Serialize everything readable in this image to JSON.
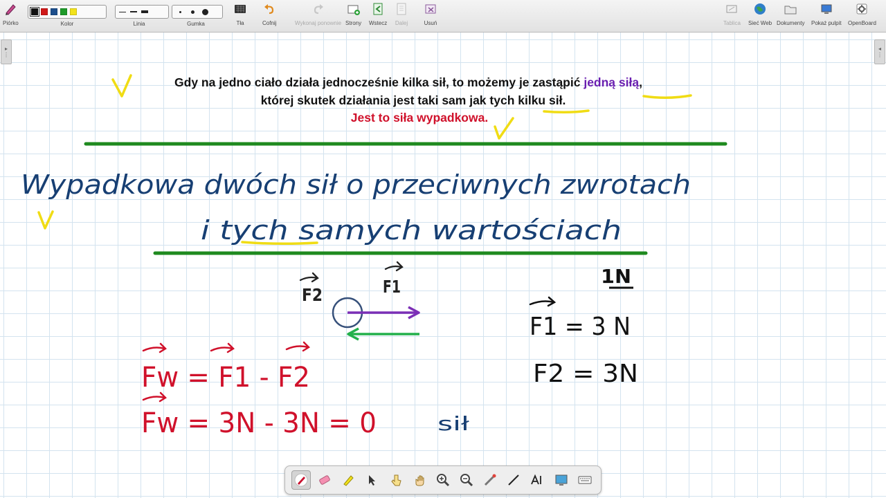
{
  "toolbar": {
    "pen": "Piórko",
    "color": "Kolor",
    "line": "Linia",
    "eraser": "Gumka",
    "backgrounds": "Tła",
    "undo": "Cofnij",
    "redo": "Wykonaj ponownie",
    "pages": "Strony",
    "back": "Wstecz",
    "next": "Dalej",
    "delete": "Usuń",
    "board": "Tablica",
    "web": "Sieć Web",
    "documents": "Dokumenty",
    "show_desktop": "Pokaż pulpit",
    "openboard": "OpenBoard"
  },
  "colors": [
    "#111111",
    "#d01919",
    "#1d4f8c",
    "#1e9a2a",
    "#f2e21b"
  ],
  "typed_text": {
    "line1_part1": "Gdy na jedno ciało działa jednocześnie kilka sił, to możemy je zastąpić ",
    "line1_highlight": "jedną siłą",
    "line1_end": ",",
    "line2": "której skutek działania jest taki sam jak tych kilku sił.",
    "line3": "Jest to siła wypadkowa."
  },
  "handwriting": {
    "title_line1": "Wypadkowa dwóch sił o przeciwnych zwrotach",
    "title_line2": "i tych samych wartościach",
    "label_f2": "F2",
    "label_f1": "F1",
    "unit_header": "1N",
    "f1_value": "F1 = 3 N",
    "f2_value": "F2 = 3N",
    "equation1": "Fw = F1 - F2",
    "equation2": "Fw = 3N - 3N = 0",
    "partial_word": "sił"
  },
  "accent_colors": {
    "highlight_purple": "#6a1fb0",
    "red_text": "#d0112b",
    "green_line": "#1f8a1f",
    "ink_blue": "#173f73",
    "ink_red": "#d0112b",
    "yellow_marker": "#f0dc14"
  },
  "float_tools": [
    "pen-tool",
    "eraser-tool",
    "marker-tool",
    "selector-tool",
    "play-tool",
    "hand-tool",
    "zoom-in-tool",
    "zoom-out-tool",
    "laser-pointer-tool",
    "line-tool",
    "text-tool",
    "capture-tool",
    "keyboard-tool"
  ]
}
